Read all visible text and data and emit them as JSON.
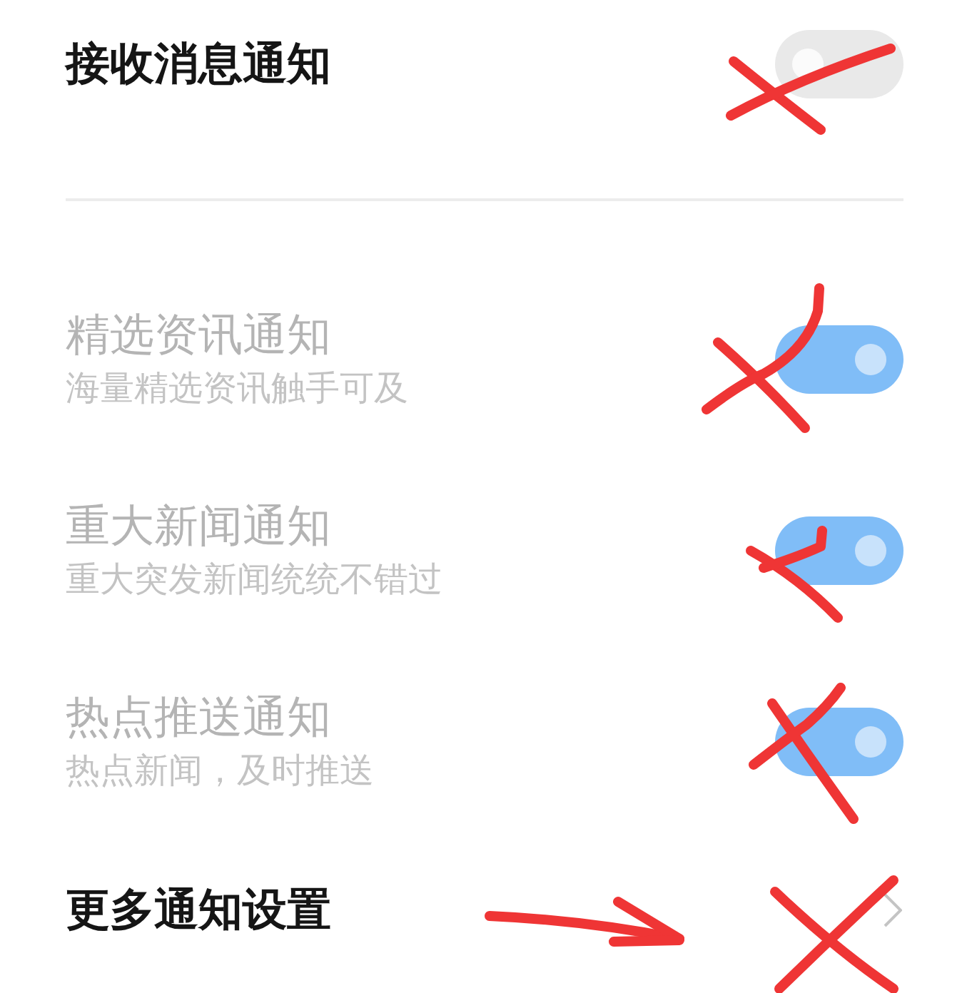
{
  "master": {
    "label": "接收消息通知",
    "on": false
  },
  "items": [
    {
      "title": "精选资讯通知",
      "subtitle": "海量精选资讯触手可及",
      "on": true,
      "disabled": true
    },
    {
      "title": "重大新闻通知",
      "subtitle": "重大突发新闻统统不错过",
      "on": true,
      "disabled": true
    },
    {
      "title": "热点推送通知",
      "subtitle": "热点新闻，及时推送",
      "on": true,
      "disabled": true
    }
  ],
  "more": {
    "label": "更多通知设置"
  }
}
